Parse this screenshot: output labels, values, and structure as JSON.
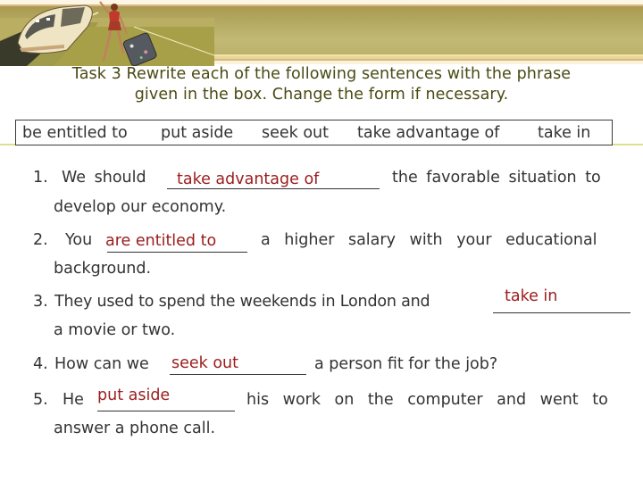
{
  "banner": {
    "image_description": "illustration of a high-speed train and a woman waving with a suitcase"
  },
  "title": {
    "line1": "Task 3 Rewrite each of the following sentences with the phrase",
    "line2": "given in the box. Change the form if necessary."
  },
  "phrase_box": {
    "phrases": [
      "be entitled to",
      "put aside",
      "seek out",
      "take advantage of",
      "take in"
    ]
  },
  "exercises": [
    {
      "number": "1.",
      "before": "We should",
      "answer": "take advantage of",
      "after": "the favorable situation to",
      "continuation": "develop our economy."
    },
    {
      "number": "2.",
      "before": "You",
      "answer": "are entitled to",
      "after": "a higher salary with your educational",
      "continuation": "background."
    },
    {
      "number": "3.",
      "before": "They used to spend the weekends in London and",
      "answer": "take in",
      "after": "",
      "continuation": "a movie or two."
    },
    {
      "number": "4.",
      "before": "How can we",
      "answer": "seek out",
      "after": "a person fit for the job?",
      "continuation": ""
    },
    {
      "number": "5.",
      "before": "He",
      "answer": "put aside",
      "after": "his work on the computer and went to",
      "continuation": "answer a phone call."
    }
  ],
  "colors": {
    "title_text": "#4a4a14",
    "body_text": "#333333",
    "answer_text": "#9b1c1c",
    "banner_band": "#b7ad66"
  }
}
